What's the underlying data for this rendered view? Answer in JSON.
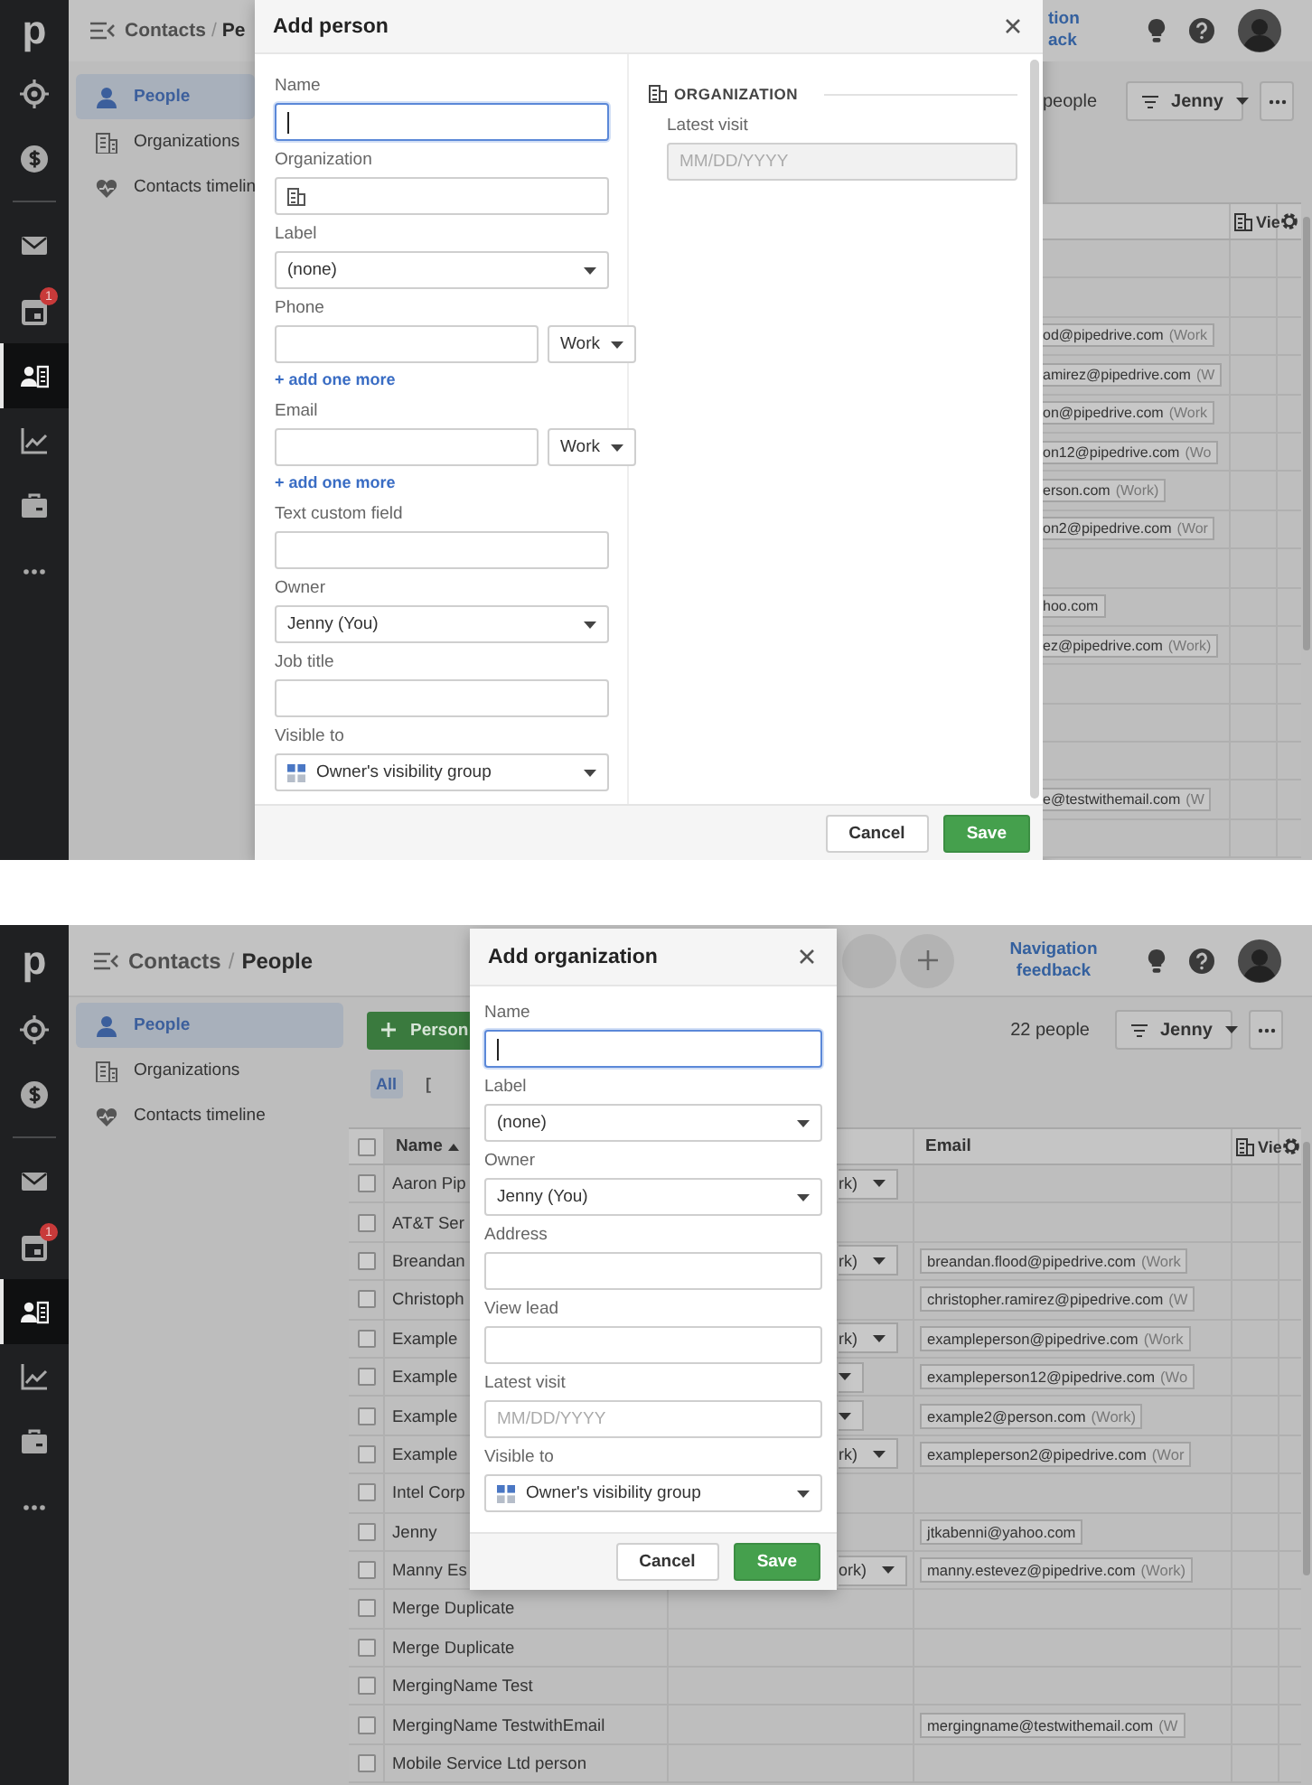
{
  "screens": [
    {
      "kind": "person_dialog",
      "rail": {
        "logo": "p",
        "items": [
          {
            "selected": false
          },
          {
            "selected": false
          },
          {
            "selected": false
          },
          {
            "selected": false,
            "badge": "1"
          },
          {
            "selected": true
          },
          {
            "selected": false
          },
          {
            "selected": false
          },
          {
            "selected": false
          }
        ]
      },
      "breadcrumb": {
        "parent": "Contacts",
        "separator": "/",
        "current": "Pe"
      },
      "sidebar": [
        {
          "label": "People",
          "selected": true
        },
        {
          "label": "Organizations",
          "selected": false
        },
        {
          "label": "Contacts timelin",
          "selected": false
        }
      ],
      "dialog": {
        "title": "Add person",
        "fields": [
          {
            "label": "Name",
            "kind": "text",
            "focused": true
          },
          {
            "label": "Organization",
            "kind": "org",
            "focused": false
          },
          {
            "label": "Label",
            "kind": "select",
            "value": "(none)"
          },
          {
            "label": "Phone",
            "kind": "pair",
            "value": "Work",
            "add_link": "+ add one more"
          },
          {
            "label": "Email",
            "kind": "pair",
            "value": "Work",
            "add_link": "+ add one more"
          },
          {
            "label": "Text custom field",
            "kind": "text",
            "focused": false
          },
          {
            "label": "Owner",
            "kind": "select",
            "value": "Jenny (You)"
          },
          {
            "label": "Job title",
            "kind": "text",
            "focused": false
          },
          {
            "label": "Visible to",
            "kind": "visibility",
            "value": "Owner's visibility group"
          }
        ],
        "section": {
          "heading": "ORGANIZATION",
          "fields": [
            {
              "label": "Latest visit",
              "kind": "date",
              "placeholder": "MM/DD/YYYY",
              "disabled": true
            }
          ]
        },
        "buttons": {
          "cancel": "Cancel",
          "save": "Save"
        }
      },
      "header": {
        "nav_feedback": [
          "tion",
          "ack"
        ]
      },
      "toolbar": {
        "count": "people",
        "filter": "Jenny"
      },
      "table": {
        "columns": {
          "view": "Vie"
        },
        "rows": [
          {},
          {},
          {
            "email": "od@pipedrive.com",
            "type": "(Work"
          },
          {
            "email": "amirez@pipedrive.com",
            "type": "(W"
          },
          {
            "email": "on@pipedrive.com",
            "type": "(Work"
          },
          {
            "email": "on12@pipedrive.com",
            "type": "(Wo"
          },
          {
            "email": "erson.com",
            "type": "(Work)"
          },
          {
            "email": "on2@pipedrive.com",
            "type": "(Wor"
          },
          {},
          {
            "email": "hoo.com"
          },
          {
            "email": "ez@pipedrive.com",
            "type": "(Work)"
          },
          {},
          {},
          {},
          {
            "email": "e@testwithemail.com",
            "type": "(W"
          },
          {}
        ]
      }
    },
    {
      "kind": "organization_dialog",
      "rail": {
        "logo": "p",
        "items": [
          {
            "selected": false
          },
          {
            "selected": false
          },
          {
            "selected": false
          },
          {
            "selected": false,
            "badge": "1"
          },
          {
            "selected": true
          },
          {
            "selected": false
          },
          {
            "selected": false
          },
          {
            "selected": false
          }
        ]
      },
      "breadcrumb": {
        "parent": "Contacts",
        "separator": "/",
        "current": "People"
      },
      "sidebar": [
        {
          "label": "People",
          "selected": true
        },
        {
          "label": "Organizations",
          "selected": false
        },
        {
          "label": "Contacts timeline",
          "selected": false
        }
      ],
      "header": {
        "nav_feedback": [
          "Navigation",
          "feedback"
        ]
      },
      "toolbar": {
        "add_button": "Person",
        "count": "22 people",
        "filter": "Jenny",
        "chips": [
          {
            "label": "All",
            "selected": true
          },
          {
            "label": "[",
            "selected": false
          }
        ]
      },
      "dialog": {
        "title": "Add organization",
        "fields": [
          {
            "label": "Name",
            "kind": "text",
            "focused": true
          },
          {
            "label": "Label",
            "kind": "select",
            "value": "(none)"
          },
          {
            "label": "Owner",
            "kind": "select",
            "value": "Jenny (You)"
          },
          {
            "label": "Address",
            "kind": "text",
            "focused": false
          },
          {
            "label": "View lead",
            "kind": "text",
            "focused": false
          },
          {
            "label": "Latest visit",
            "kind": "date",
            "placeholder": "MM/DD/YYYY",
            "disabled": false
          },
          {
            "label": "Visible to",
            "kind": "visibility",
            "value": "Owner's visibility group"
          }
        ],
        "buttons": {
          "cancel": "Cancel",
          "save": "Save"
        }
      },
      "table": {
        "header_checked": false,
        "columns": {
          "name": "Name",
          "email": "Email",
          "view": "Vie"
        },
        "rows": [
          {
            "checked": false,
            "name": "Aaron Pip",
            "phone_dropdown": true,
            "phone": "rk)"
          },
          {
            "checked": false,
            "name": "AT&T Ser",
            "phone_dropdown": false
          },
          {
            "checked": false,
            "name": "Breandan",
            "phone_dropdown": true,
            "phone": "rk)",
            "email": "breandan.flood@pipedrive.com",
            "type": "(Work"
          },
          {
            "checked": false,
            "name": "Christoph",
            "phone_dropdown": false,
            "email": "christopher.ramirez@pipedrive.com",
            "type": "(W"
          },
          {
            "checked": false,
            "name": "Example",
            "phone_dropdown": true,
            "phone": "rk)",
            "email": "exampleperson@pipedrive.com",
            "type": "(Work"
          },
          {
            "checked": false,
            "name": "Example",
            "phone_dropdown": true,
            "email": "exampleperson12@pipedrive.com",
            "type": "(Wo"
          },
          {
            "checked": false,
            "name": "Example",
            "phone_dropdown": true,
            "email": "example2@person.com",
            "type": "(Work)"
          },
          {
            "checked": false,
            "name": "Example",
            "phone_dropdown": true,
            "phone": "rk)",
            "email": "exampleperson2@pipedrive.com",
            "type": "(Wor"
          },
          {
            "checked": false,
            "name": "Intel Corp",
            "phone_dropdown": false
          },
          {
            "checked": false,
            "name": "Jenny",
            "phone_dropdown": false,
            "email": "jtkabenni@yahoo.com"
          },
          {
            "checked": false,
            "name": "Manny Es",
            "phone_dropdown": true,
            "phone": "ork)",
            "email": "manny.estevez@pipedrive.com",
            "type": "(Work)"
          },
          {
            "checked": false,
            "name": "Merge Duplicate",
            "phone_dropdown": false
          },
          {
            "checked": false,
            "name": "Merge Duplicate",
            "phone_dropdown": false
          },
          {
            "checked": false,
            "name": "MergingName Test",
            "phone_dropdown": false
          },
          {
            "checked": false,
            "name": "MergingName TestwithEmail",
            "phone_dropdown": false,
            "email": "mergingname@testwithemail.com",
            "type": "(W"
          },
          {
            "checked": false,
            "name": "Mobile Service Ltd person",
            "phone_dropdown": false
          }
        ]
      }
    }
  ]
}
